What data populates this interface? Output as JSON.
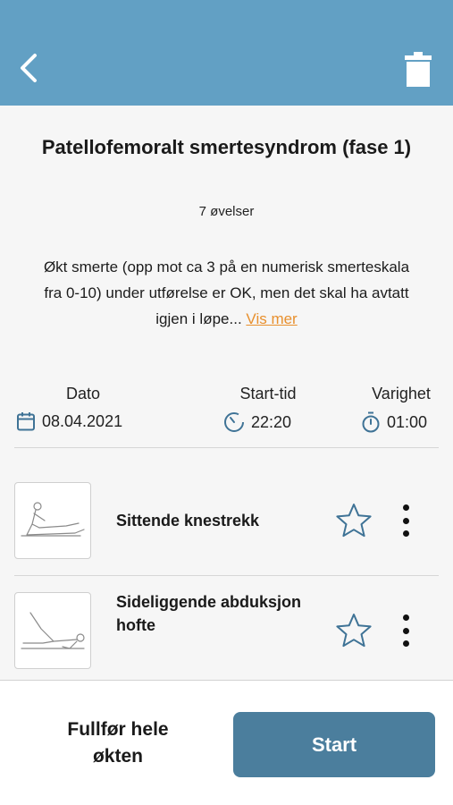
{
  "header": {
    "back_icon": "chevron-left-icon",
    "delete_icon": "trash-icon",
    "bg_color": "#62a0c4"
  },
  "program": {
    "title": "Patellofemoralt smertesyndrom (fase 1)",
    "exercise_count": "7 øvelser",
    "description": "Økt smerte (opp mot ca 3 på en numerisk smerteskala fra 0-10) under utførelse er OK, men det skal ha avtatt igjen i løpe...",
    "more_link": "Vis mer"
  },
  "meta": {
    "date_label": "Dato",
    "date_value": "08.04.2021",
    "start_label": "Start-tid",
    "start_value": "22:20",
    "duration_label": "Varighet",
    "duration_value": "01:00"
  },
  "exercises": [
    {
      "name": "Sittende knestrekk"
    },
    {
      "name": "Sideliggende abduksjon hofte"
    }
  ],
  "footer": {
    "complete_label": "Fullfør hele økten",
    "start_label": "Start",
    "start_color": "#4b7e9d"
  },
  "colors": {
    "accent_link": "#e8902e",
    "icon_blue": "#3f7396"
  }
}
